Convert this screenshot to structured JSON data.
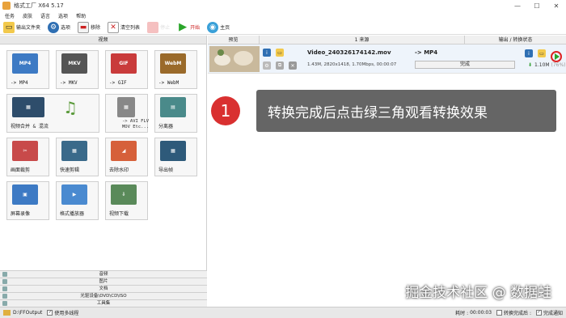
{
  "window": {
    "title": "格式工厂 X64 5.17",
    "controls": [
      "—",
      "☐",
      "✕"
    ]
  },
  "menu": [
    "任务",
    "皮肤",
    "语言",
    "选项",
    "帮助"
  ],
  "toolbar": {
    "output_folder": "输出文件夹",
    "options": "选项",
    "remove": "移除",
    "clear_list": "清空列表",
    "stop": "停止",
    "start": "开始",
    "home": "主页"
  },
  "left": {
    "category_video": "视频",
    "tiles": {
      "mp4_badge": "MP4",
      "mp4": "-> MP4",
      "mkv_badge": "MKV",
      "mkv": "-> MKV",
      "gif_badge": "GIF",
      "gif": "-> GIF",
      "webm_badge": "WebM",
      "webm": "-> WebM",
      "merge": "视频合并 & 混流",
      "avi_line1": "-> AVI FLV",
      "avi_line2": "MOV Etc...",
      "splitter": "分离器",
      "crop": "画面裁剪",
      "quick_clip": "快速剪辑",
      "watermark_remove": "去除水印",
      "export_frames": "导出帧",
      "screen_record": "屏幕录像",
      "player": "格式播放器",
      "video_download": "视频下载"
    },
    "categories": [
      "音频",
      "图片",
      "文档",
      "光驱设备\\DVD\\CD\\ISO",
      "工具集"
    ]
  },
  "table": {
    "headers": [
      "预览",
      "1 来源",
      "输出 / 转换状态"
    ],
    "rows": [
      {
        "file_name": "Video_240326174142.mov",
        "file_info": "1.43M, 2820x1418, 1.70Mbps, 00:00:07",
        "target": "-> MP4",
        "status": "完成",
        "output_size": "1.10M",
        "output_pct": "(76%)"
      }
    ]
  },
  "annotation": {
    "number": "1",
    "text": "转换完成后点击绿三角观看转换效果"
  },
  "watermark_text": "掘金技术社区 @ 数据蛙",
  "footer": {
    "path": "D:\\FFOutput",
    "multithread": "使用多线程",
    "elapsed_label": "耗时 :",
    "elapsed": "00:00:03",
    "after_convert": "转换完成后 :",
    "notify": "完成通知"
  },
  "colors": {
    "accent_red": "#d93030",
    "play_green": "#2aa52a",
    "annotation_bg": "#585858"
  }
}
